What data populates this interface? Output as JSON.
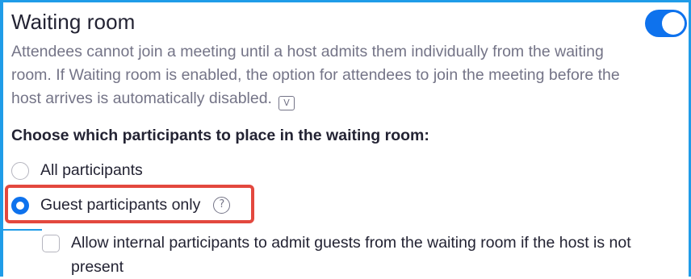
{
  "setting": {
    "title": "Waiting room",
    "toggle_on": true,
    "description": "Attendees cannot join a meeting until a host admits them individually from the waiting room. If Waiting room is enabled, the option for attendees to join the meeting before the host arrives is automatically disabled.",
    "video_icon": "V"
  },
  "choose_label": "Choose which participants to place in the waiting room:",
  "options": [
    {
      "label": "All participants",
      "selected": false
    },
    {
      "label": "Guest participants only",
      "selected": true
    }
  ],
  "help_icon": "?",
  "allow_internal": {
    "label": "Allow internal participants to admit guests from the waiting room if the host is not present",
    "checked": false
  },
  "colors": {
    "accent": "#0e72ed",
    "highlight": "#e3483e",
    "frame": "#1f9ce8"
  }
}
